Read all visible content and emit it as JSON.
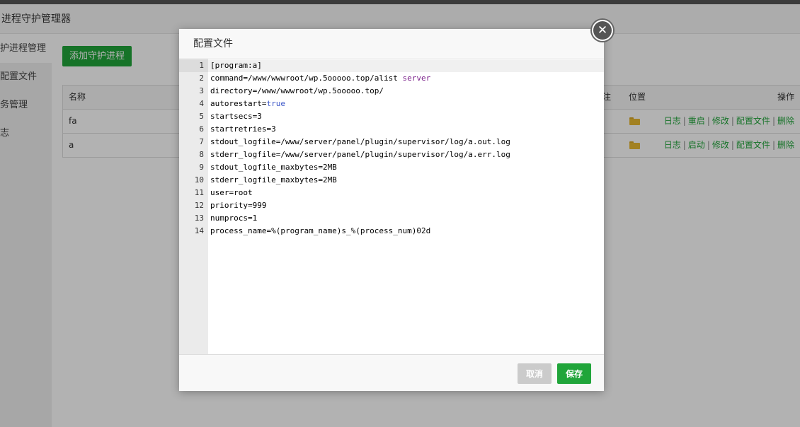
{
  "app": {
    "title": "进程守护管理器"
  },
  "sidebar": {
    "items": [
      {
        "label": "护进程管理"
      },
      {
        "label": "配置文件"
      },
      {
        "label": "务管理"
      },
      {
        "label": "志"
      }
    ]
  },
  "main": {
    "add_button": "添加守护进程",
    "table": {
      "headers": {
        "name": "名称",
        "note": "注",
        "position": "位置",
        "operations": "操作"
      },
      "rows": [
        {
          "name": "fa",
          "ops": [
            "日志",
            "重启",
            "修改",
            "配置文件",
            "删除"
          ]
        },
        {
          "name": "a",
          "ops": [
            "日志",
            "启动",
            "修改",
            "配置文件",
            "删除"
          ]
        }
      ]
    },
    "folder_icon": "folder-open-icon"
  },
  "modal": {
    "title": "配置文件",
    "close_icon": "close-icon",
    "lines": [
      {
        "num": "1",
        "text": "[program:a]"
      },
      {
        "num": "2",
        "text": "command=/www/wwwroot/wp.5ooooo.top/alist ",
        "highlight": "server"
      },
      {
        "num": "3",
        "text": "directory=/www/wwwroot/wp.5ooooo.top/"
      },
      {
        "num": "4",
        "text": "autorestart=",
        "highlight": "true"
      },
      {
        "num": "5",
        "text": "startsecs=3"
      },
      {
        "num": "6",
        "text": "startretries=3"
      },
      {
        "num": "7",
        "text": "stdout_logfile=/www/server/panel/plugin/supervisor/log/a.out.log"
      },
      {
        "num": "8",
        "text": "stderr_logfile=/www/server/panel/plugin/supervisor/log/a.err.log"
      },
      {
        "num": "9",
        "text": "stdout_logfile_maxbytes=2MB"
      },
      {
        "num": "10",
        "text": "stderr_logfile_maxbytes=2MB"
      },
      {
        "num": "11",
        "text": "user=root"
      },
      {
        "num": "12",
        "text": "priority=999"
      },
      {
        "num": "13",
        "text": "numprocs=1"
      },
      {
        "num": "14",
        "text": "process_name=%(program_name)s_%(process_num)02d"
      }
    ],
    "cancel_label": "取消",
    "save_label": "保存"
  },
  "colors": {
    "accent": "#20a53a",
    "keyword_server": "#7a1f8a",
    "keyword_true": "#3b56c8"
  }
}
